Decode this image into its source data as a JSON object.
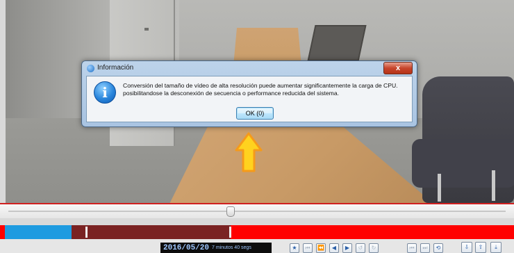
{
  "dialog": {
    "title": "Información",
    "close_symbol": "x",
    "message_line1": "Conversión del tamaño de vídeo de alta resolución puede aumentar significantemente la carga de CPU.",
    "message_line2": "posibilitandose la desconexión de secuencia o performance reducida del sistema.",
    "ok_label": "OK (0)",
    "info_icon_glyph": "i"
  },
  "status": {
    "date": "2016/05/20",
    "elapsed": "7 minutos 40 segs"
  },
  "controls": [
    {
      "name": "bookmark-star-icon",
      "glyph": "★"
    },
    {
      "name": "skip-start-icon",
      "glyph": "⏮"
    },
    {
      "name": "frame-back-icon",
      "glyph": "⏪"
    },
    {
      "name": "play-reverse-icon",
      "glyph": "◀"
    },
    {
      "name": "play-icon",
      "glyph": "▶"
    },
    {
      "name": "refresh-left-icon",
      "glyph": "↺"
    },
    {
      "name": "refresh-right-icon",
      "glyph": "↻"
    },
    {
      "name": "prev-event-icon",
      "glyph": "⏮"
    },
    {
      "name": "next-event-icon",
      "glyph": "⏭"
    },
    {
      "name": "sync-icon",
      "glyph": "⟲"
    },
    {
      "name": "zoom-in-timeline-icon",
      "glyph": "⇩"
    },
    {
      "name": "zoom-out-timeline-icon",
      "glyph": "⇧"
    },
    {
      "name": "export-icon",
      "glyph": "⤓"
    }
  ],
  "colors": {
    "accent_blue": "#1e9be0",
    "timeline_red": "#ff0000",
    "recorded_dark": "#7a2222",
    "arrow_yellow": "#ffd21f",
    "arrow_orange": "#f59a1a"
  }
}
